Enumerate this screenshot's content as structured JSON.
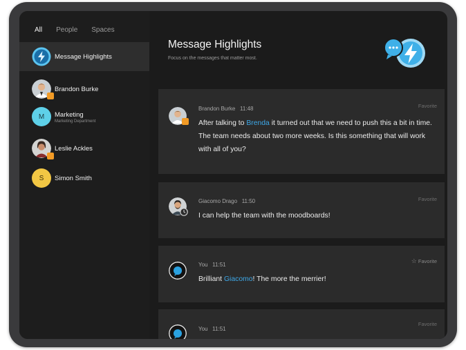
{
  "sidebar": {
    "filters": [
      "All",
      "People",
      "Spaces"
    ],
    "items": [
      {
        "label": "Message Highlights",
        "icon": "lightning-icon"
      },
      {
        "label": "Brandon Burke",
        "icon": "avatar"
      },
      {
        "label": "Marketing",
        "sub": "Marketing Department",
        "initial": "M"
      },
      {
        "label": "Leslie Ackles",
        "icon": "avatar"
      },
      {
        "label": "Simon Smith",
        "initial": "S"
      }
    ]
  },
  "header": {
    "title": "Message Highlights",
    "subtitle": "Focus on the messages that matter most."
  },
  "messages": [
    {
      "author": "Brandon Burke",
      "time": "11:48",
      "text_pre": "After talking to ",
      "mention": "Brenda",
      "text_post": " it turned out that we need to push this a bit in time. The team needs about two more weeks. Is this something that will work with all of you?",
      "favorite": "Favorite"
    },
    {
      "author": "Giacomo Drago",
      "time": "11:50",
      "text": "I can help the team with the moodboards!",
      "favorite": "Favorite"
    },
    {
      "author": "You",
      "time": "11:51",
      "text_pre": "Brilliant ",
      "mention": "Giacomo",
      "text_post": "! The more the merrier!",
      "favorite": "Favorite",
      "favorite_star": "☆"
    },
    {
      "author": "You",
      "time": "11:51",
      "favorite": "Favorite"
    }
  ],
  "colors": {
    "accent": "#3ea8e8",
    "lightning": "#5bc4f0",
    "marketing": "#5ed0e8",
    "simon": "#f2c744",
    "presence": "#f29b26"
  }
}
